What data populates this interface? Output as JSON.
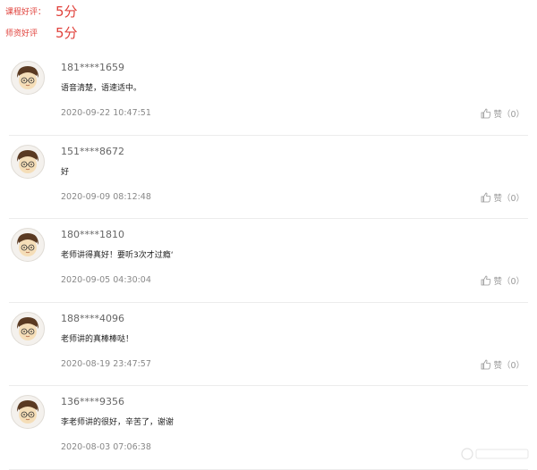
{
  "ratings": {
    "course_label": "课程好评：",
    "course_score": "5分",
    "teacher_label": "师资好评",
    "teacher_score": "5分"
  },
  "comments": [
    {
      "user": "181****1659",
      "text": "语音清楚，语速适中。",
      "time": "2020-09-22 10:47:51",
      "like": "赞（0）"
    },
    {
      "user": "151****8672",
      "text": "好",
      "time": "2020-09-09 08:12:48",
      "like": "赞（0）"
    },
    {
      "user": "180****1810",
      "text": "老师讲得真好！要听3次才过瘾‘",
      "time": "2020-09-05 04:30:04",
      "like": "赞（0）"
    },
    {
      "user": "188****4096",
      "text": "老师讲的真棒棒哒！",
      "time": "2020-08-19 23:47:57",
      "like": "赞（0）"
    },
    {
      "user": "136****9356",
      "text": "李老师讲的很好，辛苦了，谢谢",
      "time": "2020-08-03 07:06:38",
      "like": "赞（0）"
    }
  ],
  "icons": {
    "avatar": "avatar-icon",
    "like": "thumbs-up-icon"
  },
  "colors": {
    "accent": "#e0413b"
  }
}
